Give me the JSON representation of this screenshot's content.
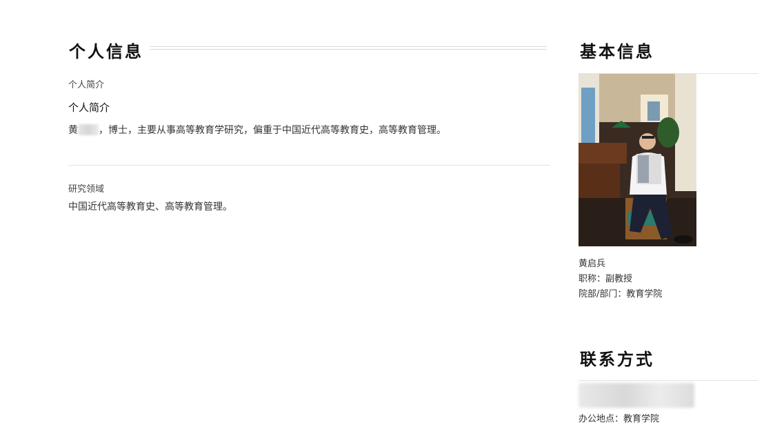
{
  "personal": {
    "heading": "个人信息",
    "intro_label": "个人简介",
    "intro_title": "个人简介",
    "intro_prefix": "黄",
    "intro_text": "，博士，主要从事高等教育学研究，偏重于中国近代高等教育史，高等教育管理。",
    "research_label": "研究领域",
    "research_text": "中国近代高等教育史、高等教育管理。"
  },
  "basic": {
    "heading": "基本信息",
    "name": "黄启兵",
    "title_line": "职称：副教授",
    "dept_line": "院部/部门：教育学院"
  },
  "contact": {
    "heading": "联系方式",
    "office_line": "办公地点：教育学院"
  }
}
